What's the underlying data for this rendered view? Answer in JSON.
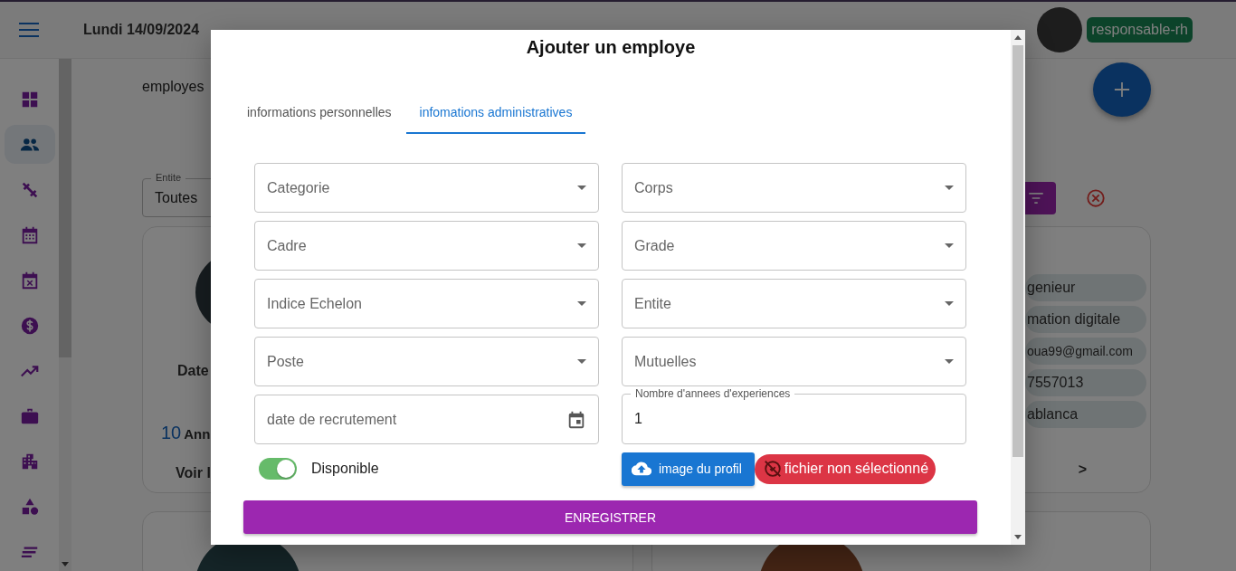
{
  "header": {
    "date": "Lundi 14/09/2024",
    "role": "responsable-rh"
  },
  "sidebar": {
    "items": [
      {
        "selected": false
      },
      {
        "selected": true
      },
      {
        "selected": false
      },
      {
        "selected": false
      },
      {
        "selected": false
      },
      {
        "selected": false
      },
      {
        "selected": false
      },
      {
        "selected": false
      },
      {
        "selected": false
      },
      {
        "selected": false
      },
      {
        "selected": false
      }
    ]
  },
  "page": {
    "title": "employes",
    "filter": {
      "label": "Entite",
      "value": "Toutes"
    },
    "left_card": {
      "date_label": "Date",
      "years_number": "10",
      "years_label": "Ann",
      "details_link": "Voir l"
    },
    "right_card": {
      "chips": [
        "genieur",
        "mation digitale",
        "oua99@gmail.com",
        "7557013",
        "ablanca"
      ],
      "next": ">"
    }
  },
  "modal": {
    "title": "Ajouter un employe",
    "tabs": [
      {
        "label": "informations personnelles",
        "selected": false
      },
      {
        "label": "infomations administratives",
        "selected": true
      }
    ],
    "fields": [
      {
        "kind": "select",
        "placeholder": "Categorie"
      },
      {
        "kind": "select",
        "placeholder": "Cadre"
      },
      {
        "kind": "select",
        "placeholder": "Indice Echelon"
      },
      {
        "kind": "select",
        "placeholder": "Poste"
      },
      {
        "kind": "date",
        "placeholder": "date de recrutement"
      },
      {
        "kind": "select",
        "placeholder": "Corps"
      },
      {
        "kind": "select",
        "placeholder": "Grade"
      },
      {
        "kind": "select",
        "placeholder": "Entite"
      },
      {
        "kind": "select",
        "placeholder": "Mutuelles"
      },
      {
        "kind": "number",
        "label": "Nombre d'annees d'experiences",
        "value": "1"
      }
    ],
    "available": {
      "label": "Disponible",
      "on": true
    },
    "upload": {
      "label": "image du profil",
      "status": "fichier non sélectionné"
    },
    "submit": "ENREGISTRER"
  }
}
